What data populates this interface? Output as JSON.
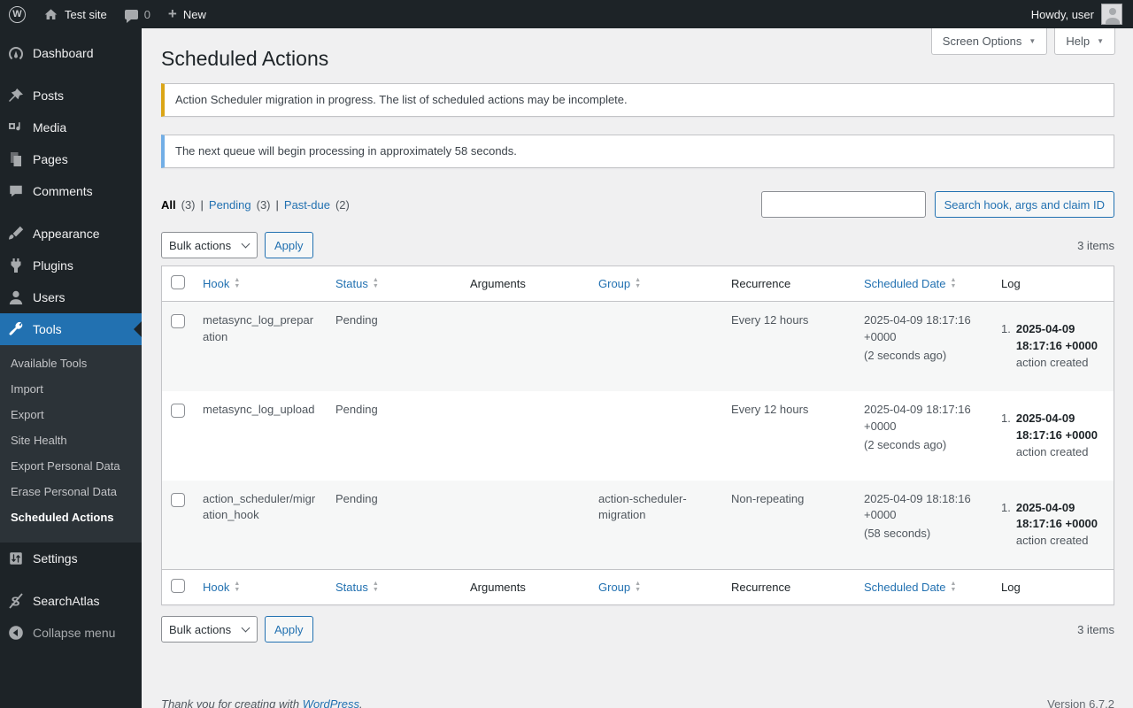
{
  "admin_bar": {
    "site_name": "Test site",
    "comments_count": "0",
    "new_label": "New",
    "howdy": "Howdy, user"
  },
  "icons": {
    "wp_logo_letter": "W",
    "plus": "+",
    "dropdown_arrow": "▼",
    "sort_up": "▲",
    "sort_down": "▼"
  },
  "sidebar": {
    "items": {
      "dashboard": "Dashboard",
      "posts": "Posts",
      "media": "Media",
      "pages": "Pages",
      "comments": "Comments",
      "appearance": "Appearance",
      "plugins": "Plugins",
      "users": "Users",
      "tools": "Tools",
      "settings": "Settings",
      "searchatlas": "SearchAtlas",
      "collapse": "Collapse menu"
    },
    "tools_submenu": {
      "available_tools": "Available Tools",
      "import": "Import",
      "export": "Export",
      "site_health": "Site Health",
      "export_personal_data": "Export Personal Data",
      "erase_personal_data": "Erase Personal Data",
      "scheduled_actions": "Scheduled Actions"
    }
  },
  "page": {
    "title": "Scheduled Actions",
    "screen_options_label": "Screen Options",
    "help_label": "Help"
  },
  "notices": {
    "migration": {
      "text": "Action Scheduler migration in progress. The list of scheduled actions may be incomplete.",
      "accent_color": "#dba617"
    },
    "queue": {
      "text": "The next queue will begin processing in approximately 58 seconds.",
      "accent_color": "#72aee6"
    }
  },
  "filters": {
    "all": {
      "label": "All",
      "count": "(3)"
    },
    "pending": {
      "label": "Pending",
      "count": "(3)"
    },
    "past_due": {
      "label": "Past-due",
      "count": "(2)"
    },
    "separator": "|"
  },
  "search": {
    "input_value": "",
    "button_label": "Search hook, args and claim ID"
  },
  "bulk": {
    "selected": "Bulk actions",
    "apply_label": "Apply",
    "items_count": "3 items"
  },
  "table": {
    "columns": {
      "hook": "Hook",
      "status": "Status",
      "arguments": "Arguments",
      "group": "Group",
      "recurrence": "Recurrence",
      "scheduled_date": "Scheduled Date",
      "log": "Log"
    },
    "rows": [
      {
        "hook": "metasync_log_preparation",
        "status": "Pending",
        "arguments": "",
        "group": "",
        "recurrence": "Every 12 hours",
        "scheduled_date": "2025-04-09 18:17:16 +0000",
        "scheduled_relative": "(2 seconds ago)",
        "log_number": "1.",
        "log_date": "2025-04-09 18:17:16 +0000",
        "log_text": "action created"
      },
      {
        "hook": "metasync_log_upload",
        "status": "Pending",
        "arguments": "",
        "group": "",
        "recurrence": "Every 12 hours",
        "scheduled_date": "2025-04-09 18:17:16 +0000",
        "scheduled_relative": "(2 seconds ago)",
        "log_number": "1.",
        "log_date": "2025-04-09 18:17:16 +0000",
        "log_text": "action created"
      },
      {
        "hook": "action_scheduler/migration_hook",
        "status": "Pending",
        "arguments": "",
        "group": "action-scheduler-migration",
        "recurrence": "Non-repeating",
        "scheduled_date": "2025-04-09 18:18:16 +0000",
        "scheduled_relative": "(58 seconds)",
        "log_number": "1.",
        "log_date": "2025-04-09 18:17:16 +0000",
        "log_text": "action created"
      }
    ]
  },
  "footer": {
    "thanks_prefix": "Thank you for creating with",
    "wordpress_link": "WordPress",
    "suffix": ".",
    "version": "Version 6.7.2"
  },
  "colors": {
    "admin_bar_bg": "#1d2327",
    "sidebar_bg": "#1d2327",
    "submenu_bg": "#2c3338",
    "active_item_bg": "#2271b1",
    "link_blue": "#2271b1",
    "warning_yellow": "#dba617",
    "info_blue": "#72aee6",
    "content_bg": "#f0f0f1",
    "stripe_gray": "#f6f7f7"
  }
}
